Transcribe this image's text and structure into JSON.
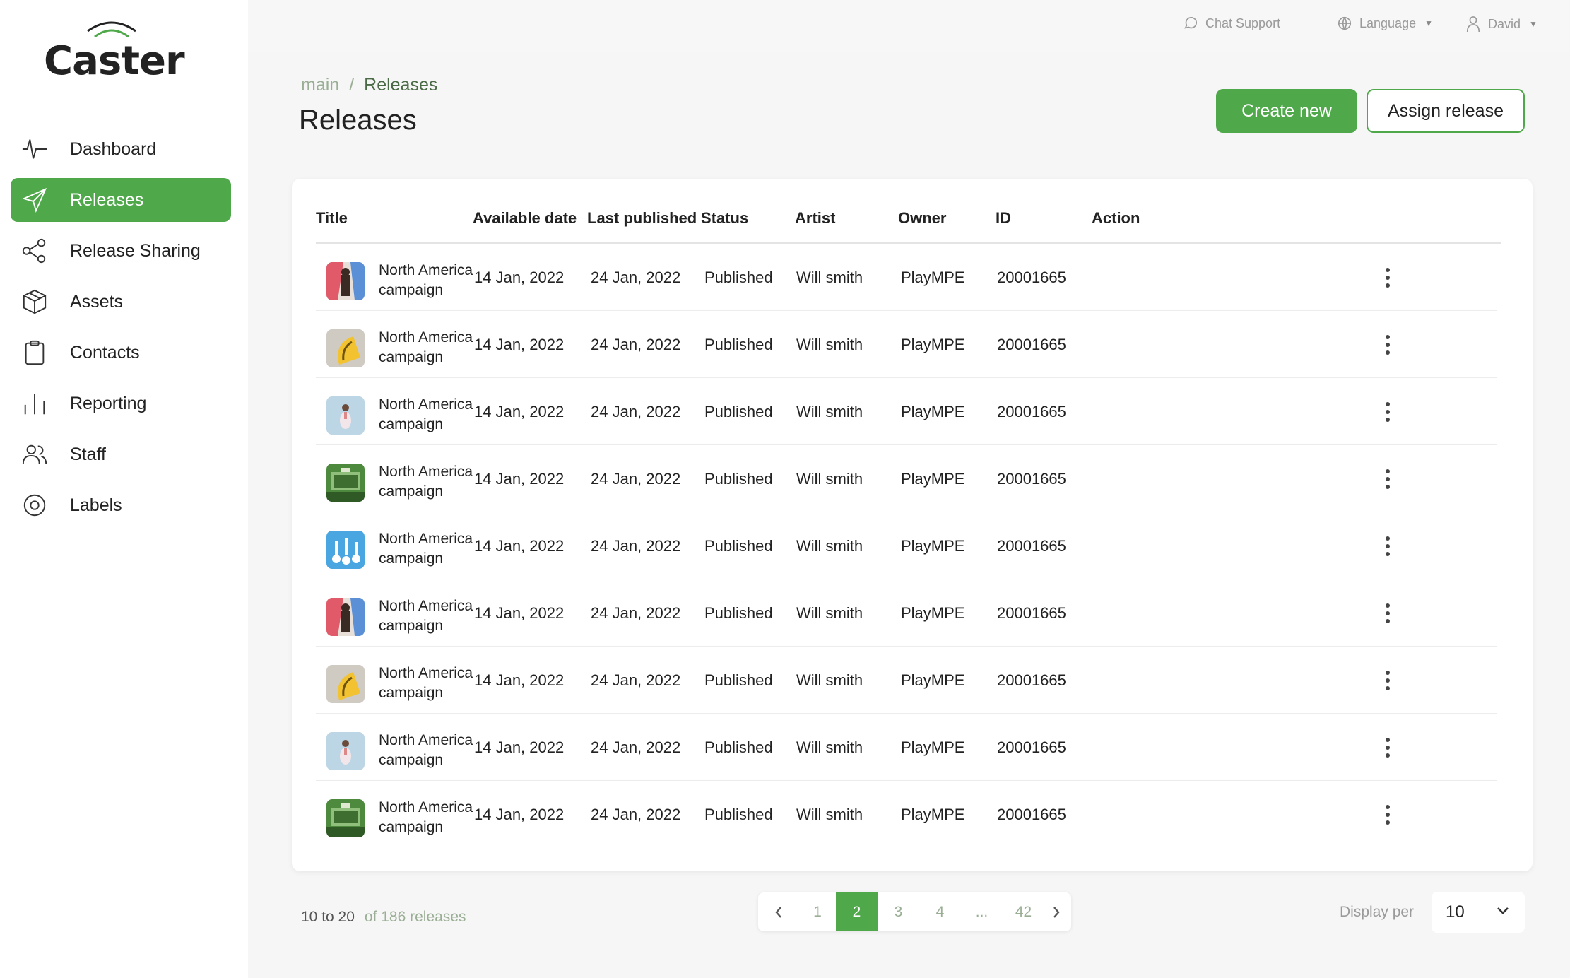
{
  "brand": {
    "name": "Caster"
  },
  "topbar": {
    "chat": "Chat Support",
    "language": "Language",
    "user": "David"
  },
  "sidebar": {
    "items": [
      {
        "label": "Dashboard",
        "icon": "activity-icon",
        "active": false
      },
      {
        "label": "Releases",
        "icon": "send-icon",
        "active": true
      },
      {
        "label": "Release Sharing",
        "icon": "share-icon",
        "active": false
      },
      {
        "label": "Assets",
        "icon": "box-icon",
        "active": false
      },
      {
        "label": "Contacts",
        "icon": "clipboard-icon",
        "active": false
      },
      {
        "label": "Reporting",
        "icon": "bar-chart-icon",
        "active": false
      },
      {
        "label": "Staff",
        "icon": "users-icon",
        "active": false
      },
      {
        "label": "Labels",
        "icon": "target-icon",
        "active": false
      }
    ]
  },
  "breadcrumb": {
    "root": "main",
    "sep": "/",
    "current": "Releases"
  },
  "page": {
    "title": "Releases",
    "create_label": "Create new",
    "assign_label": "Assign release"
  },
  "table": {
    "columns": [
      "Title",
      "Available date",
      "Last published",
      "Status",
      "Artist",
      "Owner",
      "ID",
      "Action"
    ],
    "rows": [
      {
        "title_line1": "North America",
        "title_line2": "campaign",
        "available": "14 Jan, 2022",
        "published": "24 Jan, 2022",
        "status": "Published",
        "artist": "Will smith",
        "owner": "PlayMPE",
        "id": "20001665",
        "thumb": "a"
      },
      {
        "title_line1": "North America",
        "title_line2": "campaign",
        "available": "14 Jan, 2022",
        "published": "24 Jan, 2022",
        "status": "Published",
        "artist": "Will smith",
        "owner": "PlayMPE",
        "id": "20001665",
        "thumb": "b"
      },
      {
        "title_line1": "North America",
        "title_line2": "campaign",
        "available": "14 Jan, 2022",
        "published": "24 Jan, 2022",
        "status": "Published",
        "artist": "Will smith",
        "owner": "PlayMPE",
        "id": "20001665",
        "thumb": "c"
      },
      {
        "title_line1": "North America",
        "title_line2": "campaign",
        "available": "14 Jan, 2022",
        "published": "24 Jan, 2022",
        "status": "Published",
        "artist": "Will smith",
        "owner": "PlayMPE",
        "id": "20001665",
        "thumb": "d"
      },
      {
        "title_line1": "North America",
        "title_line2": "campaign",
        "available": "14 Jan, 2022",
        "published": "24 Jan, 2022",
        "status": "Published",
        "artist": "Will smith",
        "owner": "PlayMPE",
        "id": "20001665",
        "thumb": "e"
      },
      {
        "title_line1": "North America",
        "title_line2": "campaign",
        "available": "14 Jan, 2022",
        "published": "24 Jan, 2022",
        "status": "Published",
        "artist": "Will smith",
        "owner": "PlayMPE",
        "id": "20001665",
        "thumb": "a"
      },
      {
        "title_line1": "North America",
        "title_line2": "campaign",
        "available": "14 Jan, 2022",
        "published": "24 Jan, 2022",
        "status": "Published",
        "artist": "Will smith",
        "owner": "PlayMPE",
        "id": "20001665",
        "thumb": "b"
      },
      {
        "title_line1": "North America",
        "title_line2": "campaign",
        "available": "14 Jan, 2022",
        "published": "24 Jan, 2022",
        "status": "Published",
        "artist": "Will smith",
        "owner": "PlayMPE",
        "id": "20001665",
        "thumb": "c"
      },
      {
        "title_line1": "North America",
        "title_line2": "campaign",
        "available": "14 Jan, 2022",
        "published": "24 Jan, 2022",
        "status": "Published",
        "artist": "Will smith",
        "owner": "PlayMPE",
        "id": "20001665",
        "thumb": "d"
      }
    ]
  },
  "footer": {
    "range": "10 to 20",
    "total": "of 186 releases",
    "pages": [
      "1",
      "2",
      "3",
      "4",
      "...",
      "42"
    ],
    "current_page": "2",
    "display_label": "Display per",
    "display_value": "10"
  },
  "colors": {
    "accent": "#4fa84a",
    "muted_green": "#9aae95"
  }
}
